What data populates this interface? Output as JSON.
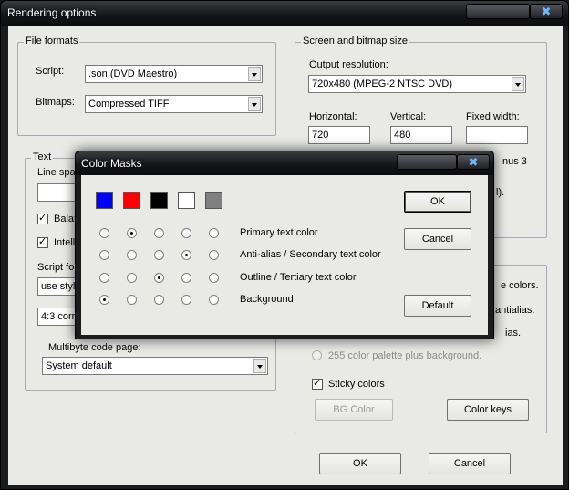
{
  "window": {
    "title": "Rendering options"
  },
  "file_formats": {
    "legend": "File formats",
    "script_label": "Script:",
    "script_value": ".son (DVD Maestro)",
    "bitmaps_label": "Bitmaps:",
    "bitmaps_value": "Compressed TIFF"
  },
  "screen": {
    "legend": "Screen and bitmap size",
    "output_label": "Output resolution:",
    "output_value": "720x480 (MPEG-2 NTSC DVD)",
    "horizontal_label": "Horizontal:",
    "horizontal_value": "720",
    "vertical_label": "Vertical:",
    "vertical_value": "480",
    "fixed_width_label": "Fixed width:",
    "fixed_width_value": "",
    "partial_1": "nus 3",
    "partial_2": "l)."
  },
  "text_group": {
    "legend": "Text",
    "line_spacing_partial": "Line spa",
    "bala_partial": "Balan",
    "intelli_partial": "Intelli",
    "script_for_partial": "Script for",
    "use_style_partial": "use style",
    "aspect_partial": "4:3 corre",
    "multibyte_label": "Multibyte code page:",
    "multibyte_value": "System default"
  },
  "colors_group": {
    "partial_colors": "e colors.",
    "partial_antialias": "antialias.",
    "partial_alias": "ias.",
    "palette_label": "255 color palette plus background.",
    "sticky_label": "Sticky colors",
    "bg_color_button": "BG Color",
    "color_keys_button": "Color keys"
  },
  "buttons": {
    "ok": "OK",
    "cancel": "Cancel"
  },
  "dialog": {
    "title": "Color Masks",
    "swatches": [
      "#0000ff",
      "#ff0000",
      "#000000",
      "#ffffff",
      "#808080"
    ],
    "rows": [
      {
        "label": "Primary text color",
        "selected": 1
      },
      {
        "label": "Anti-alias / Secondary text color",
        "selected": 3
      },
      {
        "label": "Outline / Tertiary text color",
        "selected": 2
      },
      {
        "label": "Background",
        "selected": 0
      }
    ],
    "ok_button": "OK",
    "cancel_button": "Cancel",
    "default_button": "Default"
  }
}
